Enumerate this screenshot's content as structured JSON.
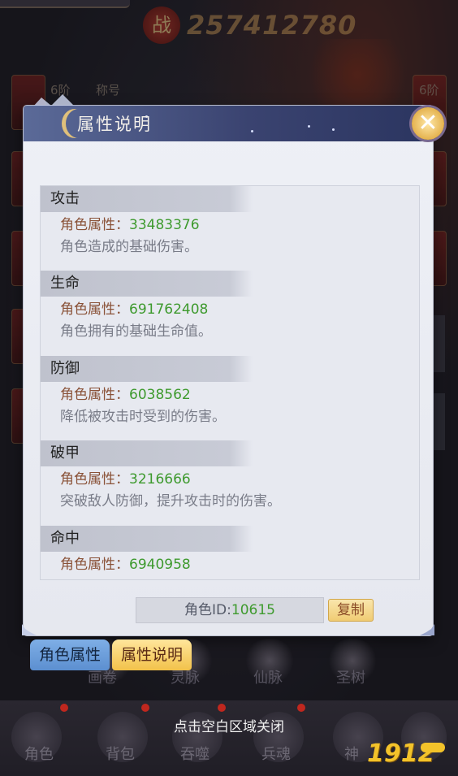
{
  "background": {
    "power_emblem": "战",
    "power_value": "257412780",
    "left_tier": "6阶",
    "right_tier": "6阶",
    "title_tab": "称号"
  },
  "dialog": {
    "title": "属性说明",
    "sections": [
      {
        "name": "攻击",
        "attr_label": "角色属性：",
        "attr_value": "33483376",
        "description": "角色造成的基础伤害。"
      },
      {
        "name": "生命",
        "attr_label": "角色属性：",
        "attr_value": "691762408",
        "description": "角色拥有的基础生命值。"
      },
      {
        "name": "防御",
        "attr_label": "角色属性：",
        "attr_value": "6038562",
        "description": "降低被攻击时受到的伤害。"
      },
      {
        "name": "破甲",
        "attr_label": "角色属性：",
        "attr_value": "3216666",
        "description": "突破敌人防御，提升攻击时的伤害。"
      },
      {
        "name": "命中",
        "attr_label": "角色属性：",
        "attr_value": "6940958",
        "description": ""
      }
    ],
    "role_id_label": "角色ID:",
    "role_id_value": "10615",
    "copy_label": "复制"
  },
  "tabs": {
    "role_attrs": "角色属性",
    "attr_desc": "属性说明"
  },
  "faded_labels": [
    "画卷",
    "灵脉",
    "仙脉",
    "圣树"
  ],
  "bottom_nav": {
    "items": [
      "角色",
      "背包",
      "吞噬",
      "兵魂",
      "神"
    ],
    "close_hint": "点击空白区域关闭"
  },
  "watermark": "1912",
  "colors": {
    "attr_value": "#3e9a2e",
    "attr_label": "#8a5238",
    "header": "#3a4370",
    "active_tab": "#f2c24a"
  }
}
